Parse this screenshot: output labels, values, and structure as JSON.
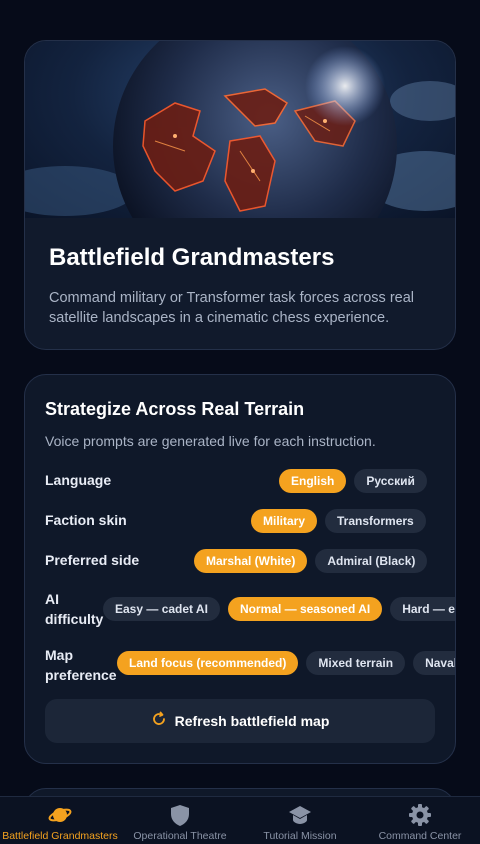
{
  "hero": {
    "title": "Battlefield Grandmasters",
    "description": "Command military or Transformer task forces across real satellite landscapes in a cinematic chess experience."
  },
  "settings": {
    "title": "Strategize Across Real Terrain",
    "subtitle": "Voice prompts are generated live for each instruction.",
    "language": {
      "label": "Language",
      "options": [
        "English",
        "Русский"
      ],
      "selected": "English"
    },
    "faction": {
      "label": "Faction skin",
      "options": [
        "Military",
        "Transformers"
      ],
      "selected": "Military"
    },
    "side": {
      "label": "Preferred side",
      "options": [
        "Marshal (White)",
        "Admiral (Black)"
      ],
      "selected": "Marshal (White)"
    },
    "ai": {
      "label_line1": "AI",
      "label_line2": "difficulty",
      "options": [
        "Easy — cadet AI",
        "Normal — seasoned AI",
        "Hard — elite AI"
      ],
      "selected": "Normal — seasoned AI"
    },
    "map": {
      "label_line1": "Map",
      "label_line2": "preference",
      "options": [
        "Land focus (recommended)",
        "Mixed terrain",
        "Naval theatre"
      ],
      "selected": "Land focus (recommended)"
    },
    "refresh_label": "Refresh battlefield map"
  },
  "nav": {
    "items": [
      {
        "label": "Battlefield Grandmasters",
        "icon": "planet-icon",
        "active": true
      },
      {
        "label": "Operational Theatre",
        "icon": "shield-icon",
        "active": false
      },
      {
        "label": "Tutorial Mission",
        "icon": "graduation-cap-icon",
        "active": false
      },
      {
        "label": "Command Center",
        "icon": "gear-icon",
        "active": false
      }
    ]
  },
  "colors": {
    "accent": "#f4a21f",
    "background": "#060b19",
    "card": "#111a2c",
    "chip": "#222c3e"
  }
}
